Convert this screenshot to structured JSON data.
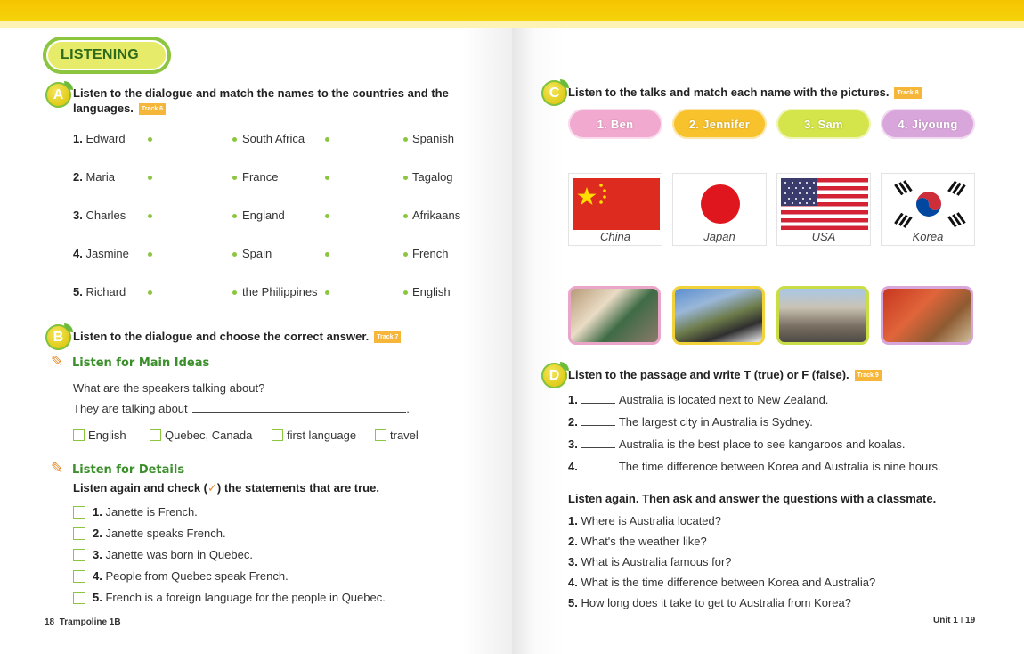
{
  "left": {
    "section_title": "LISTENING",
    "a": {
      "letter": "A",
      "instruction_line1": "Listen to the dialogue and match the names to the countries and the",
      "instruction_line2": "languages.",
      "track": "Track 6",
      "names": [
        {
          "num": "1.",
          "text": "Edward"
        },
        {
          "num": "2.",
          "text": "Maria"
        },
        {
          "num": "3.",
          "text": "Charles"
        },
        {
          "num": "4.",
          "text": "Jasmine"
        },
        {
          "num": "5.",
          "text": "Richard"
        }
      ],
      "countries": [
        "South Africa",
        "France",
        "England",
        "Spain",
        "the Philippines"
      ],
      "languages": [
        "Spanish",
        "Tagalog",
        "Afrikaans",
        "French",
        "English"
      ]
    },
    "b": {
      "letter": "B",
      "instruction": "Listen to the dialogue and choose the correct answer.",
      "track": "Track 7",
      "main_ideas_title": "Listen for Main Ideas",
      "question": "What are the speakers talking about?",
      "answer_start": "They are talking about",
      "answer_end": ".",
      "options": [
        "English",
        "Quebec, Canada",
        "first language",
        "travel"
      ],
      "details_title": "Listen for Details",
      "details_instruction_a": "Listen again and check (",
      "details_instruction_b": ") the statements that are true.",
      "statements": [
        {
          "num": "1.",
          "text": "Janette is French."
        },
        {
          "num": "2.",
          "text": "Janette speaks French."
        },
        {
          "num": "3.",
          "text": "Janette was born in Quebec."
        },
        {
          "num": "4.",
          "text": "People from Quebec speak French."
        },
        {
          "num": "5.",
          "text": "French is a foreign language for the people in Quebec."
        }
      ]
    },
    "footer_page": "18",
    "footer_book": "Trampoline 1B"
  },
  "right": {
    "c": {
      "letter": "C",
      "instruction": "Listen to the talks and match each name with the pictures.",
      "track": "Track 8",
      "names": [
        "1. Ben",
        "2. Jennifer",
        "3. Sam",
        "4. Jiyoung"
      ],
      "name_colors": [
        "#f2a9cf",
        "#f7c22c",
        "#d4e54b",
        "#d9a6dc"
      ],
      "flags": [
        "China",
        "Japan",
        "USA",
        "Korea"
      ],
      "photo_frame_colors": [
        "#e9a6c8",
        "#f2d23a",
        "#c9dd46",
        "#d9a6dc"
      ]
    },
    "d": {
      "letter": "D",
      "instruction": "Listen to the passage and write T (true) or F (false).",
      "track": "Track 9",
      "statements": [
        {
          "num": "1.",
          "text": "Australia is located next to New Zealand."
        },
        {
          "num": "2.",
          "text": "The largest city in Australia is Sydney."
        },
        {
          "num": "3.",
          "text": "Australia is the best place to see kangaroos and koalas."
        },
        {
          "num": "4.",
          "text": "The time difference between Korea and Australia is nine hours."
        }
      ],
      "again_instruction": "Listen again. Then ask and answer the questions with a classmate.",
      "questions": [
        {
          "num": "1.",
          "text": "Where is Australia located?"
        },
        {
          "num": "2.",
          "text": "What's the weather like?"
        },
        {
          "num": "3.",
          "text": "What is Australia famous for?"
        },
        {
          "num": "4.",
          "text": "What is the time difference between Korea and Australia?"
        },
        {
          "num": "5.",
          "text": "How long does it take to get to Australia from Korea?"
        }
      ]
    },
    "footer_unit": "Unit 1",
    "footer_page": "19"
  }
}
